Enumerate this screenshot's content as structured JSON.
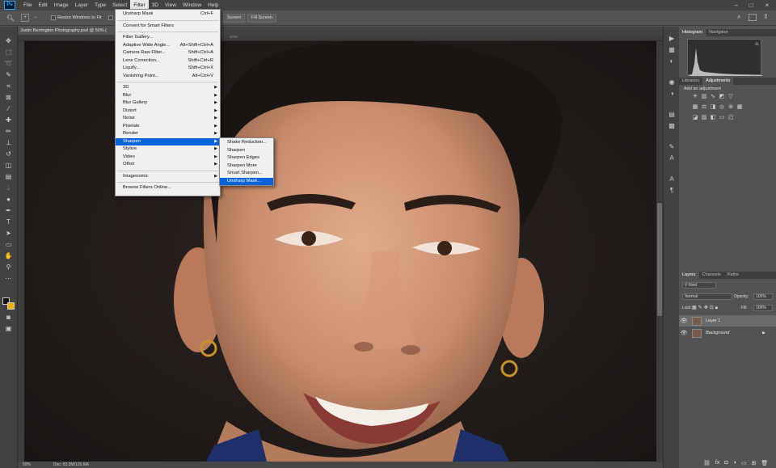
{
  "app": {
    "logo": "Ps"
  },
  "menubar": {
    "items": [
      "File",
      "Edit",
      "Image",
      "Layer",
      "Type",
      "Select",
      "Filter",
      "3D",
      "View",
      "Window",
      "Help"
    ],
    "active": "Filter"
  },
  "options": {
    "resize_label": "Resize Windows to Fit",
    "screen_btn": "Screen",
    "fill_screen_btn": "Fill Screen"
  },
  "document": {
    "tab_title": "Justin Berrington Photography.psd @ 50% (",
    "ruler_label": "2700",
    "zoom": "50%",
    "doc_size": "Doc: 63.3M/126.6M"
  },
  "filter_menu": {
    "last_filter": {
      "label": "Unsharp Mask",
      "shortcut": "Ctrl+F"
    },
    "convert": "Convert for Smart Filters",
    "group1": [
      {
        "label": "Filter Gallery...",
        "shortcut": ""
      },
      {
        "label": "Adaptive Wide Angle...",
        "shortcut": "Alt+Shift+Ctrl+A"
      },
      {
        "label": "Camera Raw Filter...",
        "shortcut": "Shift+Ctrl+A"
      },
      {
        "label": "Lens Correction...",
        "shortcut": "Shift+Ctrl+R"
      },
      {
        "label": "Liquify...",
        "shortcut": "Shift+Ctrl+X"
      },
      {
        "label": "Vanishing Point...",
        "shortcut": "Alt+Ctrl+V"
      }
    ],
    "submenus": [
      "3D",
      "Blur",
      "Blur Gallery",
      "Distort",
      "Noise",
      "Pixelate",
      "Render",
      "Sharpen",
      "Stylize",
      "Video",
      "Other"
    ],
    "highlighted": "Sharpen",
    "plugin": "Imagenomic",
    "browse": "Browse Filters Online..."
  },
  "sharpen_menu": {
    "items": [
      "Shake Reduction...",
      "Sharpen",
      "Sharpen Edges",
      "Sharpen More",
      "Smart Sharpen...",
      "Unsharp Mask..."
    ],
    "highlighted": "Unsharp Mask..."
  },
  "panels": {
    "top_tabs": [
      "Histogram",
      "Navigator"
    ],
    "mid_tabs": [
      "Libraries",
      "Adjustments"
    ],
    "add_adjustment": "Add an adjustment",
    "layer_tabs": [
      "Layers",
      "Channels",
      "Paths"
    ],
    "kind_label": "Kind",
    "blend_mode": "Normal",
    "opacity_label": "Opacity:",
    "opacity_value": "100%",
    "lock_label": "Lock:",
    "fill_label": "Fill:",
    "fill_value": "100%",
    "layers": [
      {
        "name": "Layer 1",
        "selected": true
      },
      {
        "name": "Background",
        "selected": false
      }
    ]
  },
  "colors": {
    "foreground": "#111111",
    "background": "#f0b400",
    "menu_highlight": "#0a64d8"
  }
}
